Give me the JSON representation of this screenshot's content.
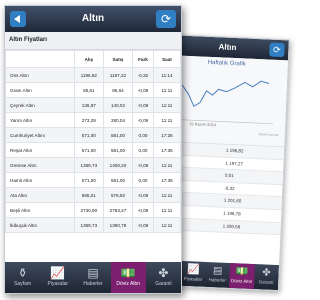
{
  "app": {
    "title": "Altın"
  },
  "section_title": "Altın Fiyatları",
  "table": {
    "headers": [
      "",
      "Alış",
      "Satış",
      "Fark",
      "Saat"
    ],
    "rows": [
      {
        "name": "Ons Altın",
        "alis": "1196,82",
        "satis": "1197,22",
        "fark": "-0,32",
        "saat": "11:14"
      },
      {
        "name": "Gram Altın",
        "alis": "85,61",
        "satis": "85,64",
        "fark": "-0,09",
        "saat": "11:11"
      },
      {
        "name": "Çeyrek Altın",
        "alis": "136,97",
        "satis": "140,02",
        "fark": "-0,09",
        "saat": "11:11"
      },
      {
        "name": "Yarım Altın",
        "alis": "273,29",
        "satis": "280,04",
        "fark": "-0,09",
        "saat": "11:11"
      },
      {
        "name": "Cumhuriyet Altını",
        "alis": "571,00",
        "satis": "581,00",
        "fark": "0,00",
        "saat": "17:36"
      },
      {
        "name": "Reşat Altın",
        "alis": "571,00",
        "satis": "581,00",
        "fark": "0,00",
        "saat": "17:36"
      },
      {
        "name": "Gremse Altın",
        "alis": "1369,73",
        "satis": "1400,20",
        "fark": "-0,09",
        "saat": "11:11"
      },
      {
        "name": "Hamit Altın",
        "alis": "571,00",
        "satis": "581,00",
        "fark": "0,00",
        "saat": "17:36"
      },
      {
        "name": "Ata Altın",
        "alis": "565,01",
        "satis": "578,92",
        "fark": "-0,09",
        "saat": "11:11"
      },
      {
        "name": "Beşli Altın",
        "alis": "2730,90",
        "satis": "2783,27",
        "fark": "-0,09",
        "saat": "11:11"
      },
      {
        "name": "İkibuçuk Altın",
        "alis": "1369,73",
        "satis": "1390,78",
        "fark": "-0,09",
        "saat": "11:11"
      }
    ]
  },
  "tabs": [
    {
      "label": "Sayfam",
      "icon": "piggy-bank-icon",
      "glyph": "⚱",
      "active": false
    },
    {
      "label": "Piyasalar",
      "icon": "chart-icon",
      "glyph": "📈",
      "active": false
    },
    {
      "label": "Haberler",
      "icon": "news-icon",
      "glyph": "▤",
      "active": false
    },
    {
      "label": "Döviz Altın",
      "icon": "currency-icon",
      "glyph": "💵",
      "active": true
    },
    {
      "label": "Garanti",
      "icon": "clover-icon",
      "glyph": "✤",
      "active": false
    }
  ],
  "back_screen": {
    "title": "Altın",
    "chart_title": "Haftalık Grafik",
    "chart_date": "19 Kasım 2014",
    "chart_source": "Sitenin Kaynak",
    "rows": [
      {
        "label": "",
        "value": "1 196,82"
      },
      {
        "label": "",
        "value": "1 197,27"
      },
      {
        "label": "me",
        "value": "0,01"
      },
      {
        "label": "",
        "value": "-0,32"
      },
      {
        "label": "",
        "value": "1 201,60"
      },
      {
        "label": "",
        "value": "1 196,78"
      },
      {
        "label": "ş",
        "value": "1 200,56"
      }
    ]
  },
  "colors": {
    "accent": "#2f7fc2",
    "active_tab": "#7d1f6f",
    "bar_dark": "#1f2838"
  }
}
